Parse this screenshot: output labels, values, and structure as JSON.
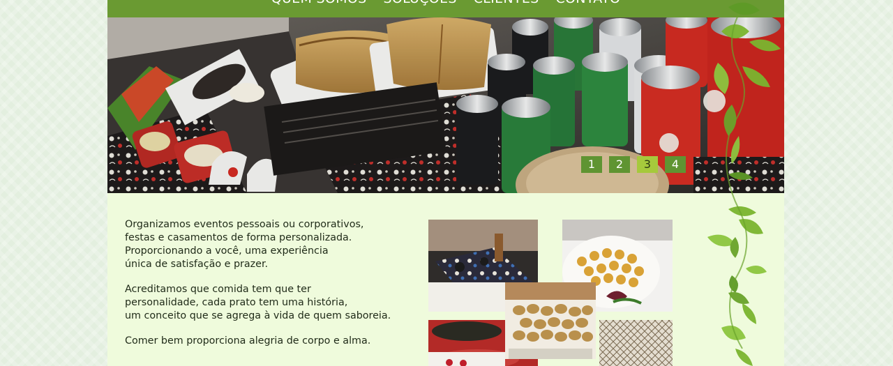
{
  "nav": {
    "items": [
      "QUEM SOMOS",
      "SOLUÇÕES",
      "CLIENTES",
      "CONTATO"
    ]
  },
  "slider": {
    "pages": [
      "1",
      "2",
      "3",
      "4"
    ],
    "active_index": 2
  },
  "intro": {
    "paragraphs": [
      "Organizamos eventos pessoais ou corporativos,\nfestas e casamentos de forma personalizada.\nProporcionando a você, uma experiência\núnica de satisfação e prazer.",
      "Acreditamos que comida tem que ter\npersonalidade, cada prato tem uma história,\num conceito que se agrega à vida de quem saboreia.",
      "Comer bem proporciona alegria de corpo e alma."
    ]
  },
  "colors": {
    "nav_green": "#6a9a32",
    "page_background": "#effbdc",
    "slider_active": "#a6c93c",
    "leaf_green": "#7bb52f"
  }
}
